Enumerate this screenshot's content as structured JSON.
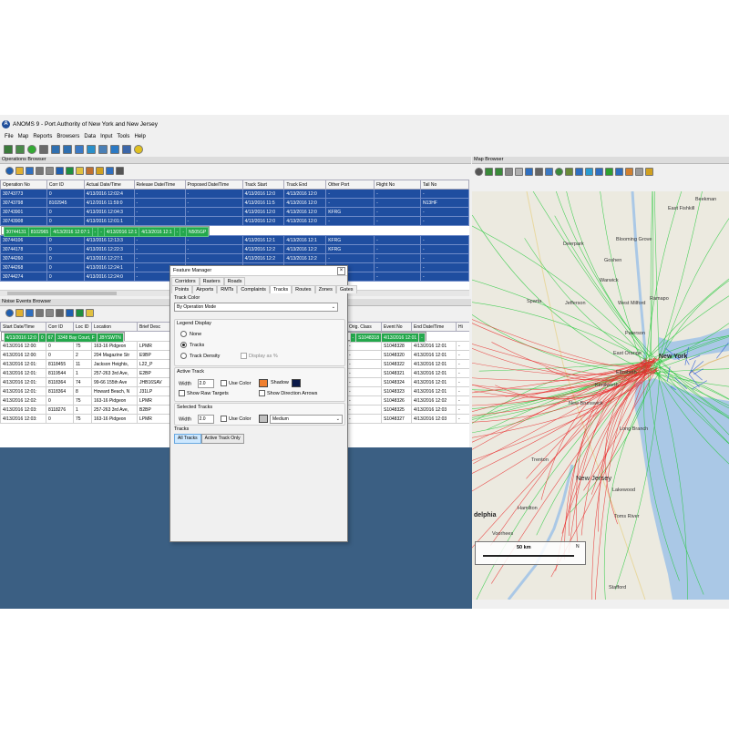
{
  "app": {
    "title": "ANOMS 9 - Port Authority of New York and New Jersey",
    "menu": [
      "File",
      "Map",
      "Reports",
      "Browsers",
      "Data",
      "Input",
      "Tools",
      "Help"
    ]
  },
  "operations": {
    "title": "Operations Browser",
    "columns": [
      "Operation No",
      "Corr ID",
      "Actual Date/Time",
      "Release Date/Time",
      "Proposed Date/Time",
      "Track Start",
      "Track End",
      "Other Port",
      "Flight No",
      "Tail No"
    ],
    "rows": [
      [
        "30743773",
        "0",
        "4/13/2016 12:02:4",
        "-",
        "-",
        "4/13/2016 12:0",
        "4/13/2016 12:0",
        "-",
        "-",
        "-"
      ],
      [
        "30743798",
        "8102945",
        "4/12/2016 11:59:0",
        "-",
        "-",
        "4/13/2016 11:5",
        "4/13/2016 12:0",
        "-",
        "-",
        "N13HF"
      ],
      [
        "30743901",
        "0",
        "4/13/2016 12:04:3",
        "-",
        "-",
        "4/13/2016 12:0",
        "4/13/2016 12:0",
        "KFRG",
        "-",
        "-"
      ],
      [
        "30743908",
        "0",
        "4/13/2016 12:01:1",
        "-",
        "-",
        "4/13/2016 12:0",
        "4/13/2016 12:0",
        "-",
        "-",
        "-"
      ],
      [
        "30744131",
        "8102965",
        "4/13/2016 12:07:1",
        "-",
        "-",
        "4/13/2016 12:1",
        "4/13/2016 12:1",
        "-",
        "-",
        "N505GP"
      ],
      [
        "30744106",
        "0",
        "4/13/2016 12:13:3",
        "-",
        "-",
        "4/13/2016 12:1",
        "4/13/2016 12:1",
        "KFRG",
        "-",
        "-"
      ],
      [
        "30744178",
        "0",
        "4/13/2016 12:22:3",
        "-",
        "-",
        "4/13/2016 12:2",
        "4/13/2016 12:2",
        "KFRG",
        "-",
        "-"
      ],
      [
        "30744260",
        "0",
        "4/13/2016 12:27:1",
        "-",
        "-",
        "4/13/2016 12:2",
        "4/13/2016 12:2",
        "-",
        "-",
        "-"
      ],
      [
        "30744268",
        "0",
        "4/13/2016 12:24:1",
        "-",
        "-",
        "4/13/2016 12:2",
        "4/13/2016 12:2",
        "KFRG",
        "-",
        "-"
      ],
      [
        "30744274",
        "0",
        "4/13/2016 12:24:0",
        "-",
        "-",
        "4/13/2016 12:2",
        "4/13/2016 12:2",
        "-",
        "-",
        "-"
      ]
    ],
    "selected_index": 4
  },
  "noise": {
    "title": "Noise Events Browser",
    "columns_left": [
      "Start Date/Time",
      "Corr ID",
      "Loc ID",
      "Location",
      "Brief Desc"
    ],
    "columns_right": [
      "Orig. Class",
      "Event No",
      "End Date/Time",
      "Hi"
    ],
    "rows_left": [
      [
        "4/13/2016 12:0",
        "0",
        "67",
        "3348 Bay Court, F",
        "JBYSWTN"
      ],
      [
        "4/13/2016 12:00:",
        "0",
        "75",
        "163-16 Pidgeon",
        "LPMR"
      ],
      [
        "4/13/2016 12:00:",
        "0",
        "2",
        "204 Magazine Str",
        "E9BP"
      ],
      [
        "4/13/2016 12:01:",
        "8118455",
        "11",
        "Jackson Heights,",
        "L22_P"
      ],
      [
        "4/13/2016 12:01:",
        "8119544",
        "1",
        "257-263 3rd Ave,",
        "E2BP"
      ],
      [
        "4/13/2016 12:01:",
        "8118364",
        "74",
        "99-66 155th Ave",
        "JHB16SAV"
      ],
      [
        "4/13/2016 12:01:",
        "8118364",
        "8",
        "Howard Beach, N",
        "J31LP"
      ],
      [
        "4/13/2016 12:02:",
        "0",
        "75",
        "163-16 Pidgeon",
        "LPMR"
      ],
      [
        "4/13/2016 12:03:",
        "8118276",
        "1",
        "257-263 3rd Ave,",
        "B2BP"
      ],
      [
        "4/13/2016 12:03:",
        "0",
        "75",
        "163-16 Pidgeon",
        "LPMR"
      ]
    ],
    "rows_right": [
      [
        "-",
        "S1048318",
        "4/13/2016 12:01",
        "-"
      ],
      [
        "-",
        "S1048328",
        "4/13/2016 12:01",
        "-"
      ],
      [
        "-",
        "S1048320",
        "4/13/2016 12:01",
        "-"
      ],
      [
        "-",
        "S1048322",
        "4/13/2016 12:01",
        "-"
      ],
      [
        "-",
        "S1048321",
        "4/13/2016 12:01",
        "-"
      ],
      [
        "-",
        "S1048324",
        "4/13/2016 12:01",
        "-"
      ],
      [
        "-",
        "S1048323",
        "4/13/2016 12:01",
        "-"
      ],
      [
        "-",
        "S1048326",
        "4/13/2016 12:02",
        "-"
      ],
      [
        "-",
        "S1048325",
        "4/13/2016 12:03",
        "-"
      ],
      [
        "-",
        "S1048327",
        "4/13/2016 12:03",
        "-"
      ]
    ],
    "selected_index": 0
  },
  "feature_manager": {
    "title": "Feature Manager",
    "tabs_row1": [
      "Corridors",
      "Rasters",
      "Roads"
    ],
    "tabs_row2": [
      "Points",
      "Airports",
      "RMTs",
      "Complaints",
      "Tracks",
      "Routes",
      "Zones",
      "Gates"
    ],
    "active_tab": "Tracks",
    "track_color_label": "Track Color",
    "track_color_value": "By Operation Mode",
    "legend_label": "Legend Display",
    "legend_options": [
      "None",
      "Tracks",
      "Track Density"
    ],
    "legend_selected": "Tracks",
    "display_pct": "Display as %",
    "active_track_label": "Active Track",
    "width_label": "Width",
    "active_width": "2.0",
    "use_color": "Use Color",
    "shadow": "Shadow",
    "show_raw_targets": "Show Raw Targets",
    "show_direction_arrows": "Show Direction Arrows",
    "selected_tracks_label": "Selected Tracks",
    "selected_width": "2.0",
    "selected_size": "Medium",
    "tracks_label": "Tracks",
    "btn_all": "All Tracks",
    "btn_active": "Active Track Only",
    "colors": {
      "use_color": "#f07f2e",
      "shadow": "#0b1a4a",
      "selected_swatch": "#c0c0c0"
    }
  },
  "map": {
    "title": "Map Browser",
    "labels": {
      "beekman": "Beekman",
      "east_fishkill": "East Fishkill",
      "deerpark": "Deerpark",
      "blooming_grove": "Blooming Grove",
      "goshen": "Goshen",
      "warwick": "Warwick",
      "sparta": "Sparta",
      "jefferson": "Jefferson",
      "west_milford": "West Milford",
      "ramapo": "Ramapo",
      "east_orange": "East Orange",
      "new_york": "New York",
      "elizabeth": "Elizabeth",
      "new_brunswick": "New Brunswick",
      "trenton": "Trenton",
      "new_jersey": "New Jersey",
      "long_branch": "Long Branch",
      "lakewood": "Lakewood",
      "toms_river": "Toms River",
      "philadelphia": "delphia",
      "hamilton": "Hamilton",
      "voorhees": "Voorhees",
      "stafford": "Stafford",
      "paterson": "Paterson",
      "kenilworth": "Kenilworth",
      "scale": "50 km",
      "north": "N"
    },
    "colors": {
      "water": "#aac8e6",
      "land": "#eceae0",
      "green": "#22c838",
      "red": "#e82828",
      "blue": "#2a5ad8"
    }
  }
}
